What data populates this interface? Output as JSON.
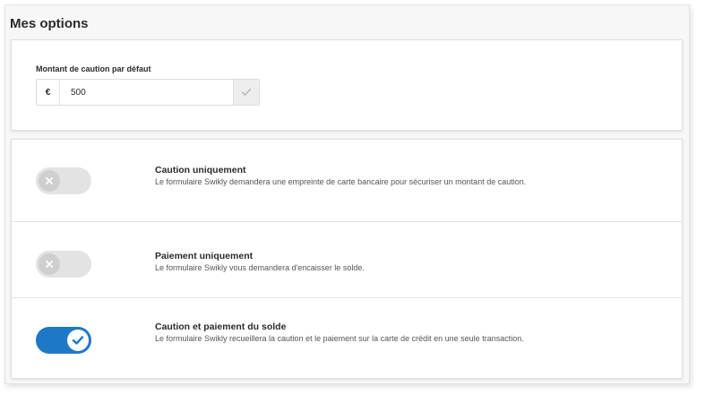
{
  "page": {
    "title": "Mes options"
  },
  "amount": {
    "label": "Montant de caution par défaut",
    "currency": "€",
    "value": "500",
    "confirm_icon": "check-icon"
  },
  "options": [
    {
      "title": "Caution uniquement",
      "description": "Le formulaire Swikly demandera une empreinte de carte bancaire pour sécuriser un montant de caution.",
      "enabled": false
    },
    {
      "title": "Paiement uniquement",
      "description": "Le formulaire Swikly vous demandera d'encaisser le solde.",
      "enabled": false
    },
    {
      "title": "Caution et paiement du solde",
      "description": "Le formulaire Swikly recueillera la caution et le paiement sur la carte de crédit en une seule transaction.",
      "enabled": true
    }
  ],
  "colors": {
    "toggle_on": "#1e78c8",
    "toggle_off": "#e3e3e3"
  }
}
